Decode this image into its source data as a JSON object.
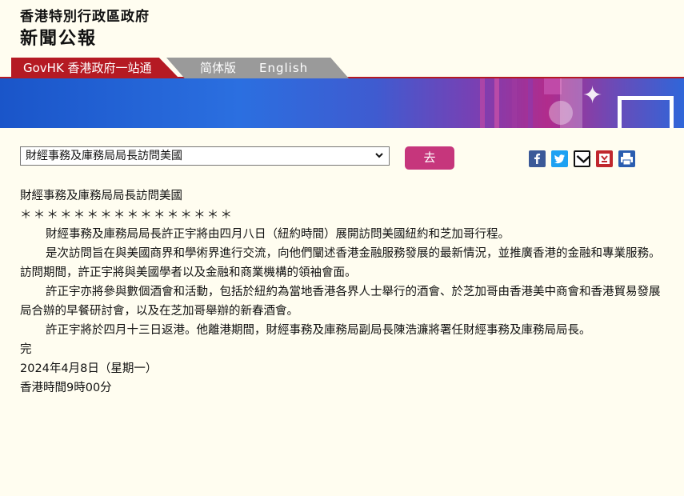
{
  "header": {
    "gov_name": "香港特別行政區政府",
    "section": "新聞公報"
  },
  "nav": {
    "govhk": "GovHK 香港政府一站通",
    "simplified": "简体版",
    "english": "English"
  },
  "controls": {
    "select_value": "財經事務及庫務局局長訪問美國",
    "go_label": "去"
  },
  "share_icons": [
    "facebook-icon",
    "twitter-icon",
    "email-icon",
    "bookmark-icon",
    "print-icon"
  ],
  "colors": {
    "brand_red": "#b51a23",
    "button_pink": "#c6367c",
    "facebook": "#3b5998",
    "twitter": "#1da1f2",
    "bookmark": "#c0272d",
    "print": "#2a5db0"
  },
  "article": {
    "title": "財經事務及庫務局局長訪問美國",
    "stars": "＊＊＊＊＊＊＊＊＊＊＊＊＊＊＊＊",
    "paragraphs": [
      "財經事務及庫務局局長許正宇將由四月八日（紐約時間）展開訪問美國紐約和芝加哥行程。",
      "是次訪問旨在與美國商界和學術界進行交流，向他們闡述香港金融服務發展的最新情況，並推廣香港的金融和專業服務。訪問期間，許正宇將與美國學者以及金融和商業機構的領袖會面。",
      "許正宇亦將參與數個酒會和活動，包括於紐約為當地香港各界人士舉行的酒會、於芝加哥由香港美中商會和香港貿易發展局合辦的早餐研討會，以及在芝加哥舉辦的新春酒會。",
      "許正宇將於四月十三日返港。他離港期間，財經事務及庫務局副局長陳浩濂將署任財經事務及庫務局局長。"
    ],
    "end": "完",
    "date": "2024年4月8日（星期一）",
    "time": "香港時間9時00分"
  }
}
